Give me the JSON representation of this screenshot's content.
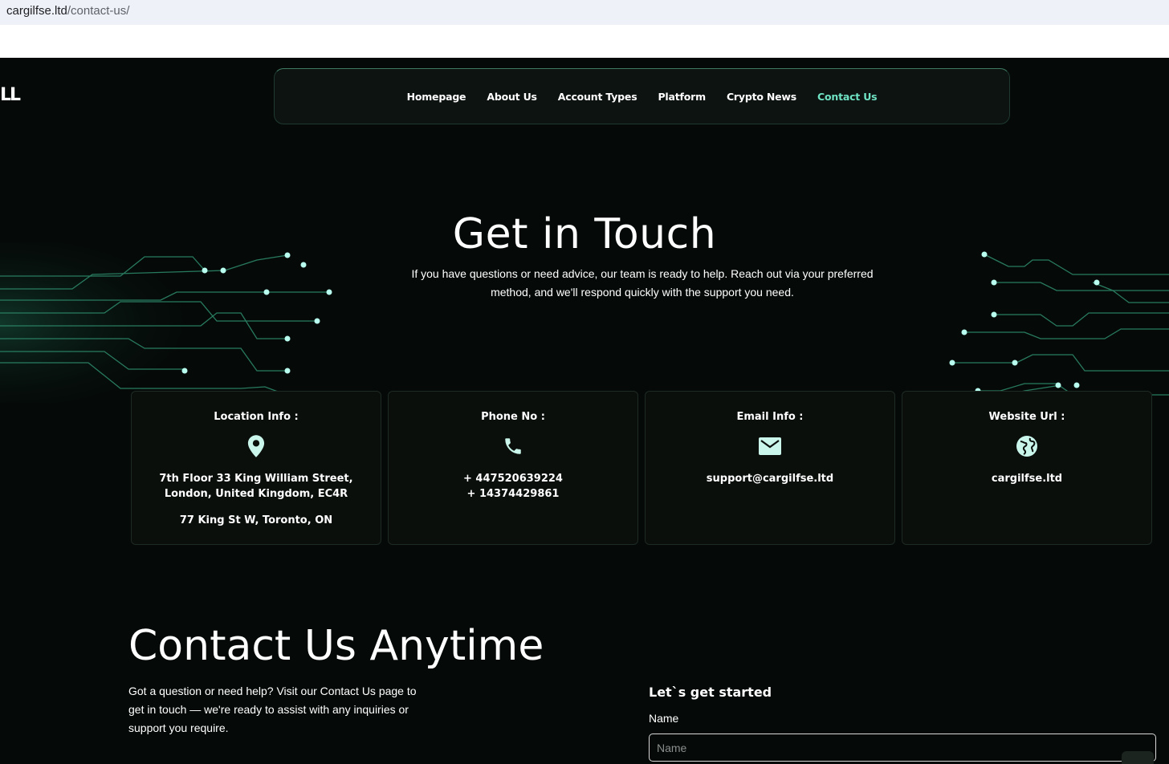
{
  "browser": {
    "url_host": "cargilfse.ltd",
    "url_path": "/contact-us/"
  },
  "logo": {
    "fragment": "LL"
  },
  "nav": {
    "items": [
      {
        "label": "Homepage"
      },
      {
        "label": "About Us"
      },
      {
        "label": "Account Types"
      },
      {
        "label": "Platform"
      },
      {
        "label": "Crypto News"
      },
      {
        "label": "Contact Us"
      }
    ],
    "active_color": "#6fe3c4"
  },
  "hero": {
    "title": "Get in Touch",
    "subtitle": "If you have questions or need advice, our team is ready to help. Reach out via your preferred method, and we'll respond quickly with the support you need."
  },
  "cards": [
    {
      "title": "Location Info :",
      "icon": "location-pin-icon",
      "lines": [
        "7th Floor 33 King William Street, London, United Kingdom, EC4R"
      ],
      "extra": "77 King St W, Toronto, ON"
    },
    {
      "title": "Phone No :",
      "icon": "phone-icon",
      "lines": [
        "+ 447520639224",
        "+ 14374429861"
      ],
      "extra": ""
    },
    {
      "title": "Email Info :",
      "icon": "mail-icon",
      "lines": [
        "support@cargilfse.ltd"
      ],
      "extra": ""
    },
    {
      "title": "Website Url :",
      "icon": "globe-icon",
      "lines": [
        "cargilfse.ltd"
      ],
      "extra": ""
    }
  ],
  "contact": {
    "title": "Contact Us Anytime",
    "subtitle": "Got a question or need help? Visit our Contact Us page to get in touch — we're ready to assist with any inquiries or support you require."
  },
  "form": {
    "heading": "Let`s get started",
    "name_label": "Name",
    "name_placeholder": "Name",
    "name_value": ""
  },
  "colors": {
    "accent": "#6fe3c4",
    "icon": "#c9f5ea",
    "background": "#050a08"
  }
}
